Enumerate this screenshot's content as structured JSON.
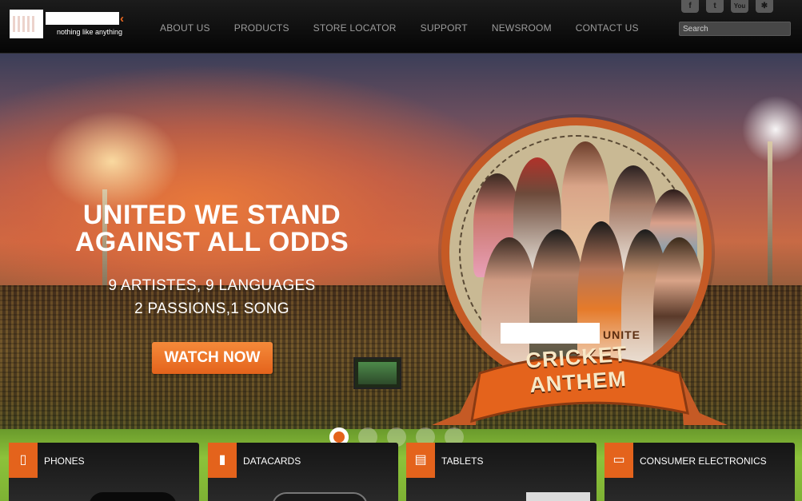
{
  "header": {
    "tagline": "nothing like anything",
    "nav": [
      "ABOUT US",
      "PRODUCTS",
      "STORE LOCATOR",
      "SUPPORT",
      "NEWSROOM",
      "CONTACT US"
    ],
    "social": [
      {
        "icon": "facebook-icon",
        "glyph": "f"
      },
      {
        "icon": "twitter-icon",
        "glyph": "t"
      },
      {
        "icon": "youtube-icon",
        "glyph": "You"
      },
      {
        "icon": "app-icon",
        "glyph": "✱"
      }
    ],
    "search_placeholder": "Search"
  },
  "hero": {
    "headline_line1": "UNITED WE STAND",
    "headline_line2": "AGAINST ALL ODDS",
    "sub_line1": "9 ARTISTES, 9 LANGUAGES",
    "sub_line2": "2 PASSIONS,1 SONG",
    "cta": "WATCH NOW",
    "badge_unite": "UNITE",
    "badge_title": "CRICKET ANTHEM",
    "slider_total": 5,
    "slider_active": 1
  },
  "categories": [
    {
      "label": "PHONES",
      "icon": "phone-icon",
      "glyph": "▯"
    },
    {
      "label": "DATACARDS",
      "icon": "datacard-icon",
      "glyph": "▮"
    },
    {
      "label": "TABLETS",
      "icon": "tablet-icon",
      "glyph": "▤"
    },
    {
      "label": "CONSUMER ELECTRONICS",
      "icon": "tv-icon",
      "glyph": "▭"
    }
  ],
  "colors": {
    "accent": "#e4631c",
    "header_bg": "#0a0a0a",
    "nav_text": "#9c9c9c"
  }
}
